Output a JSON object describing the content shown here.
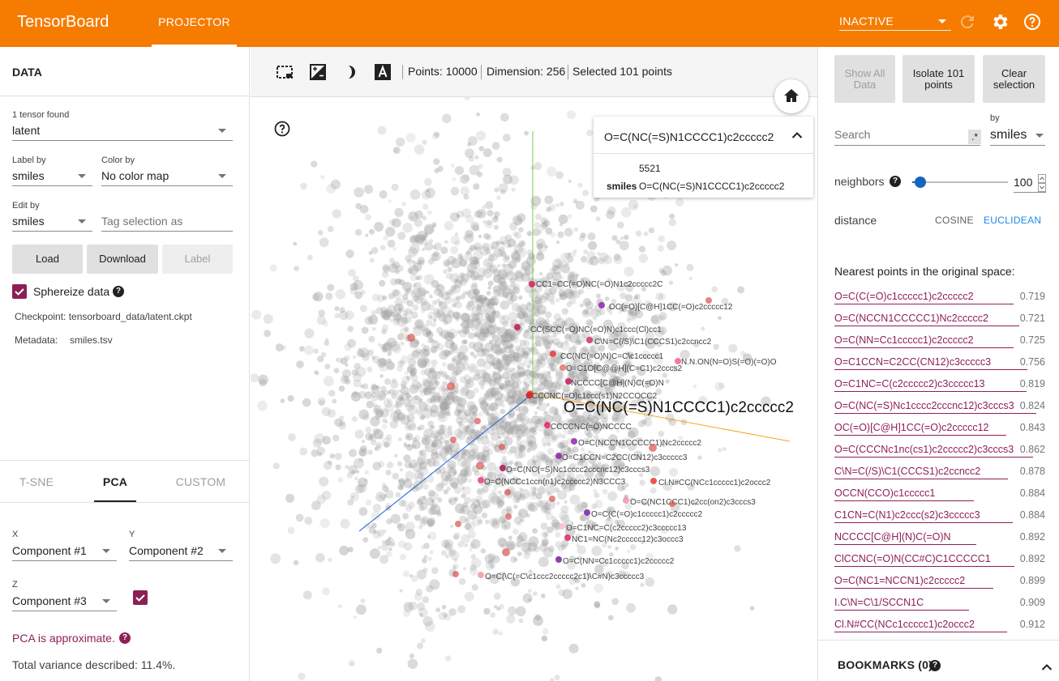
{
  "header": {
    "brand": "TensorBoard",
    "tab": "PROJECTOR",
    "run_status": "INACTIVE",
    "icons": [
      "refresh-icon",
      "settings-icon",
      "help-icon"
    ]
  },
  "data_panel": {
    "title": "DATA",
    "tensor_found": "1 tensor found",
    "tensor_value": "latent",
    "label_by_label": "Label by",
    "label_by_value": "smiles",
    "color_by_label": "Color by",
    "color_by_value": "No color map",
    "edit_by_label": "Edit by",
    "edit_by_value": "smiles",
    "tag_placeholder": "Tag selection as",
    "load": "Load",
    "download": "Download",
    "label_btn": "Label",
    "sphereize": "Sphereize data",
    "checkpoint": "Checkpoint: tensorboard_data/latent.ckpt",
    "metadata_label": "Metadata:",
    "metadata_value": "smiles.tsv"
  },
  "projection": {
    "tabs": [
      "T-SNE",
      "PCA",
      "CUSTOM"
    ],
    "x_label": "X",
    "x_value": "Component #1",
    "y_label": "Y",
    "y_value": "Component #2",
    "z_label": "Z",
    "z_value": "Component #3",
    "pca_note": "PCA is approximate.",
    "variance": "Total variance described: 11.4%."
  },
  "toolbar": {
    "points": "Points: 10000",
    "dimension": "Dimension: 256",
    "selected": "Selected 101 points"
  },
  "info_card": {
    "title": "O=C(NC(=S)N1CCCC1)c2ccccc2",
    "index": "5521",
    "key": "smiles",
    "value": "O=C(NC(=S)N1CCCC1)c2ccccc2"
  },
  "scene": {
    "main_label": "O=C(NC(=S)N1CCCC1)c2ccccc2",
    "labels": [
      "CC1=CC(=O)NC(=O)N1c2ccccc2C",
      "OC(=O)[C@H]1CC(=O)c2ccccc12",
      "CC(SCC(=O)NC(=O)N)c1ccc(Cl)cc1",
      "C\\N=C(/S)\\C1(CCCS1)c2ccncc2",
      "CC(NC(=O)N)C=C\\c1ccccc1",
      "N.N.ON(N=O)S(=O)(=O)O",
      "O=C1O[C@@H](C=C1)c2cccs2",
      "NCCCC[C@H](N)C(=O)N",
      "CCCNC(=O)c1ccc(s1)N2CCOCC2",
      "CCCCNC(=O)NCCCC",
      "O=C(NCCN1CCCCC1)Nc2ccccc2",
      "O=C1CCN=C2CC(CN12)c3ccccc3",
      "O=C(NC(=S)Nc1cccc2cccnc12)c3cccs3",
      "O=C(NCCc1ccn(n1)c2ccccc2)N3CCC3",
      "Cl.N#CC(NCc1ccccc1)c2occc2",
      "O=C(NC1CCC1)c2cc(on2)c3cccs3",
      "O=C(C(=O)c1ccccc1)c2ccccc2",
      "O=C1NC=C(c2ccccc2)c3ccccc13",
      "NC1=NC(Nc2ccccc12)c3occc3",
      "O=C(NN=Cc1ccccc1)c2ccccc2",
      "O=C(\\C(=C\\c1ccc2ccccc2c1)\\C#N)c3ccccc3"
    ]
  },
  "inspector": {
    "show_all": "Show All Data",
    "isolate": "Isolate 101 points",
    "clear": "Clear selection",
    "search_placeholder": "Search",
    "regex": ".*",
    "by_label": "by",
    "by_value": "smiles",
    "neighbors_label": "neighbors",
    "neighbors_value": "100",
    "distance_label": "distance",
    "cosine": "COSINE",
    "euclidean": "EUCLIDEAN",
    "nearest_title": "Nearest points in the original space:",
    "nearest": [
      {
        "name": "O=C(C(=O)c1ccccc1)c2ccccc2",
        "value": "0.719"
      },
      {
        "name": "O=C(NCCN1CCCCC1)Nc2ccccc2",
        "value": "0.721"
      },
      {
        "name": "O=C(NN=Cc1ccccc1)c2ccccc2",
        "value": "0.725"
      },
      {
        "name": "O=C1CCN=C2CC(CN12)c3ccccc3",
        "value": "0.756"
      },
      {
        "name": "O=C1NC=C(c2ccccc2)c3ccccc13",
        "value": "0.819"
      },
      {
        "name": "O=C(NC(=S)Nc1cccc2cccnc12)c3cccs3",
        "value": "0.824"
      },
      {
        "name": "OC(=O)[C@H]1CC(=O)c2ccccc12",
        "value": "0.843"
      },
      {
        "name": "O=C(CCCNc1nc(cs1)c2ccccc2)c3cccs3",
        "value": "0.862"
      },
      {
        "name": "C\\N=C(/S)\\C1(CCCS1)c2ccncc2",
        "value": "0.878"
      },
      {
        "name": "OCCN(CCO)c1ccccc1",
        "value": "0.884"
      },
      {
        "name": "C1CN=C(N1)c2ccc(s2)c3ccccc3",
        "value": "0.884"
      },
      {
        "name": "NCCCC[C@H](N)C(=O)N",
        "value": "0.892"
      },
      {
        "name": "ClCCNC(=O)N(CC#C)C1CCCCC1",
        "value": "0.892"
      },
      {
        "name": "O=C(NC1=NCCN1)c2ccccc2",
        "value": "0.899"
      },
      {
        "name": "I.C\\N=C\\1/SCCN1C",
        "value": "0.909"
      },
      {
        "name": "Cl.N#CC(NCc1ccccc1)c2occc2",
        "value": "0.912"
      }
    ],
    "bookmarks": "BOOKMARKS (0)"
  }
}
